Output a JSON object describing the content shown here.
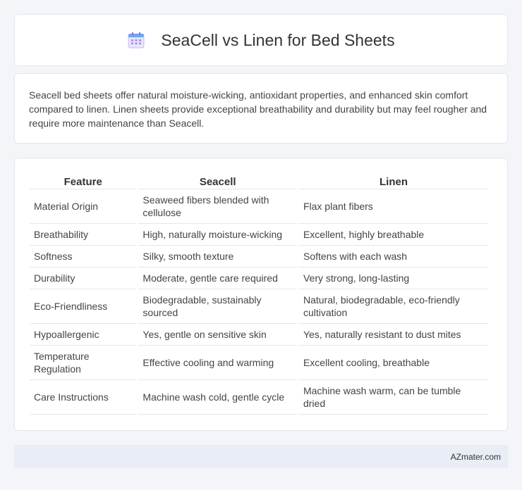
{
  "header": {
    "title": "SeaCell vs Linen for Bed Sheets",
    "icon": "calendar-icon"
  },
  "summary": {
    "text": "Seacell bed sheets offer natural moisture-wicking, antioxidant properties, and enhanced skin comfort compared to linen. Linen sheets provide exceptional breathability and durability but may feel rougher and require more maintenance than Seacell."
  },
  "table": {
    "headers": [
      "Feature",
      "Seacell",
      "Linen"
    ],
    "rows": [
      [
        "Material Origin",
        "Seaweed fibers blended with cellulose",
        "Flax plant fibers"
      ],
      [
        "Breathability",
        "High, naturally moisture-wicking",
        "Excellent, highly breathable"
      ],
      [
        "Softness",
        "Silky, smooth texture",
        "Softens with each wash"
      ],
      [
        "Durability",
        "Moderate, gentle care required",
        "Very strong, long-lasting"
      ],
      [
        "Eco-Friendliness",
        "Biodegradable, sustainably sourced",
        "Natural, biodegradable, eco-friendly cultivation"
      ],
      [
        "Hypoallergenic",
        "Yes, gentle on sensitive skin",
        "Yes, naturally resistant to dust mites"
      ],
      [
        "Temperature Regulation",
        "Effective cooling and warming",
        "Excellent cooling, breathable"
      ],
      [
        "Care Instructions",
        "Machine wash cold, gentle cycle",
        "Machine wash warm, can be tumble dried"
      ]
    ]
  },
  "footer": {
    "brand": "AZmater.com"
  }
}
